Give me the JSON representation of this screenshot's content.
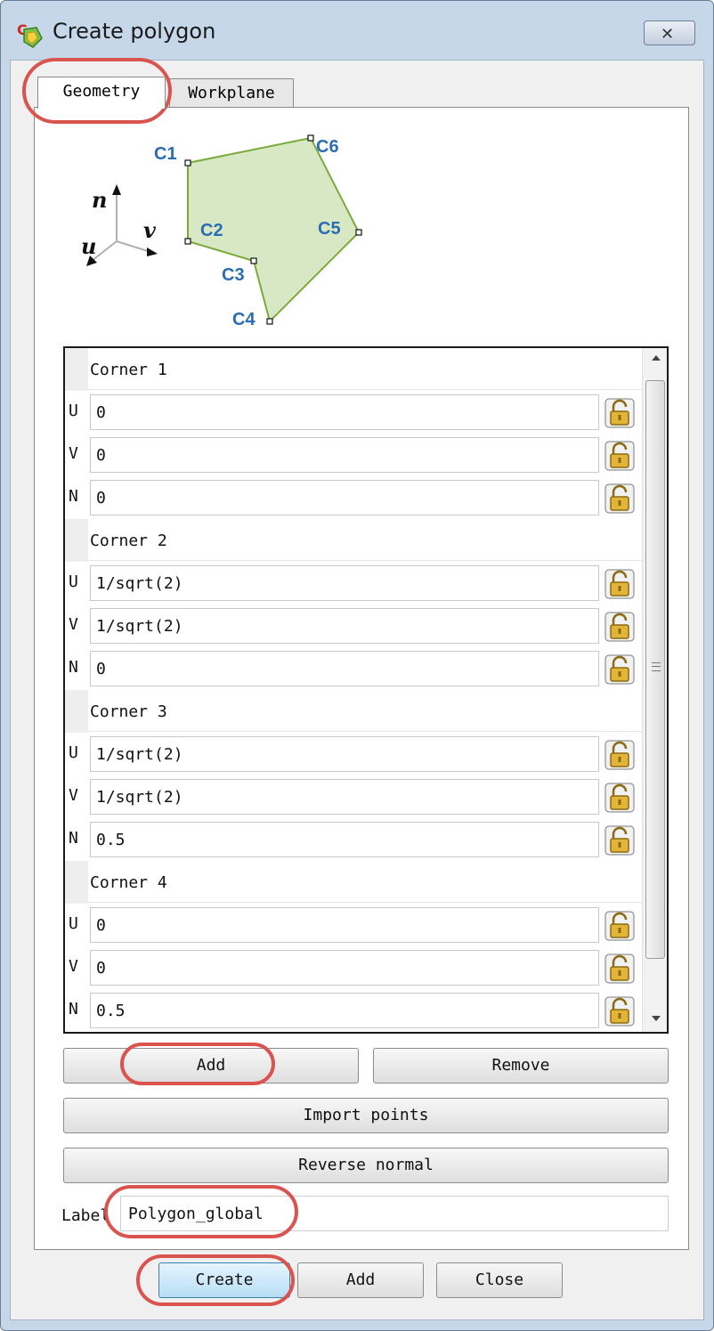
{
  "window": {
    "title": "Create polygon",
    "close_glyph": "✕"
  },
  "tabs": [
    {
      "label": "Geometry",
      "active": true
    },
    {
      "label": "Workplane",
      "active": false
    }
  ],
  "diagram": {
    "axis_labels": {
      "n": "n",
      "u": "u",
      "v": "v"
    },
    "corner_labels": [
      "C1",
      "C2",
      "C3",
      "C4",
      "C5",
      "C6"
    ],
    "fill_color": "#d9e8c4",
    "stroke_color": "#7aaa3a",
    "label_color": "#2a6db5"
  },
  "corners": [
    {
      "name": "Corner 1",
      "U": "0",
      "V": "0",
      "N": "0"
    },
    {
      "name": "Corner 2",
      "U": "1/sqrt(2)",
      "V": "1/sqrt(2)",
      "N": "0"
    },
    {
      "name": "Corner 3",
      "U": "1/sqrt(2)",
      "V": "1/sqrt(2)",
      "N": "0.5"
    },
    {
      "name": "Corner 4",
      "U": "0",
      "V": "0",
      "N": "0.5"
    }
  ],
  "buttons": {
    "add": "Add",
    "remove": "Remove",
    "import_points": "Import points",
    "reverse_normal": "Reverse normal",
    "create": "Create",
    "add_bottom": "Add",
    "close": "Close"
  },
  "label_field": {
    "label": "Label",
    "value": "Polygon_global"
  },
  "highlight_color": "#d9534f",
  "lock_icon_color": "#e2b43a"
}
